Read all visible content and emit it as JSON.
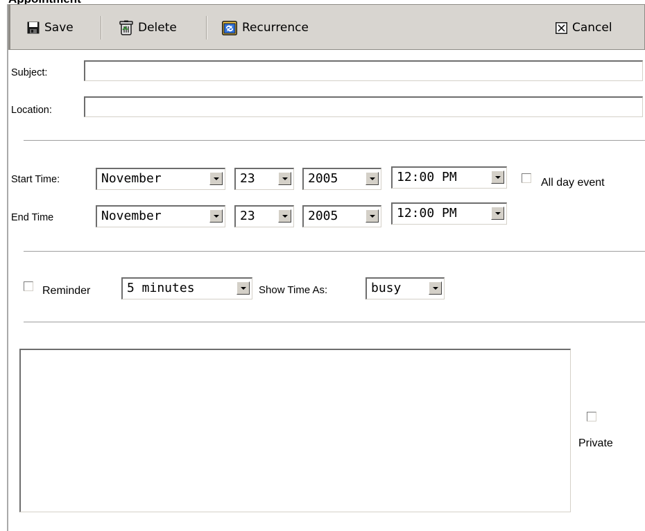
{
  "header": {
    "title": "Appointment"
  },
  "toolbar": {
    "save_label": "Save",
    "delete_label": "Delete",
    "recurrence_label": "Recurrence",
    "cancel_label": "Cancel"
  },
  "form": {
    "subject_label": "Subject:",
    "subject_value": "",
    "location_label": "Location:",
    "location_value": "",
    "start_label": "Start Time:",
    "start": {
      "month": "November",
      "day": "23",
      "year": "2005",
      "time": "12:00 PM"
    },
    "all_day_label": "All day event",
    "all_day_checked": false,
    "end_label": "End Time",
    "end": {
      "month": "November",
      "day": "23",
      "year": "2005",
      "time": "12:00 PM"
    },
    "reminder_label": "Reminder",
    "reminder_checked": false,
    "reminder_value": "5 minutes",
    "show_time_as_label": "Show Time As:",
    "show_time_as_value": "busy",
    "notes_value": "",
    "private_label": "Private",
    "private_checked": false
  },
  "icons": {
    "save": "floppy-disk-icon",
    "delete": "trash-can-icon",
    "recurrence": "recurrence-calendar-icon",
    "cancel": "close-box-icon"
  }
}
